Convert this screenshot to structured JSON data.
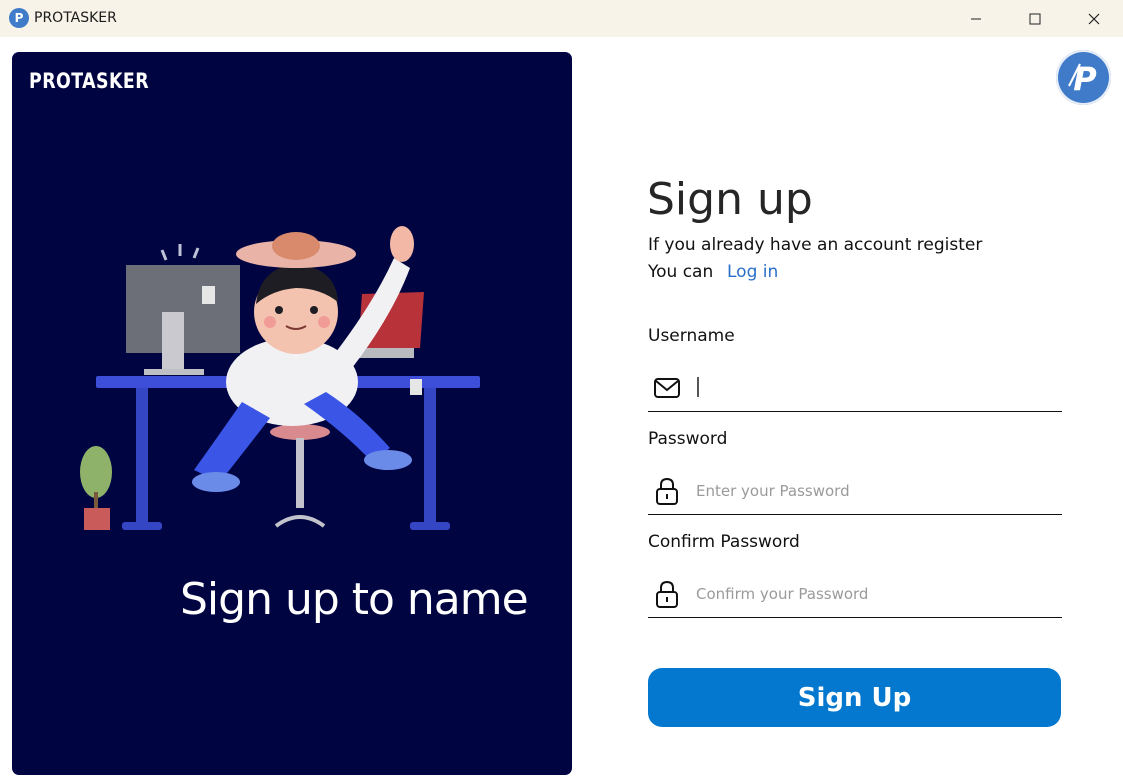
{
  "window": {
    "title": "PROTASKER",
    "logo_letter": "P"
  },
  "left_panel": {
    "brand": "PROTASKER",
    "tagline": "Sign up to name",
    "bg_color": "#000541"
  },
  "corner_logo": {
    "letter": "P",
    "color": "#3f7bc9"
  },
  "form": {
    "heading": "Sign up",
    "subtitle_line1": "If you already have an account register",
    "subtitle_line2": "You can",
    "login_link": "Log in",
    "username_label": "Username",
    "username_value": "",
    "password_label": "Password",
    "password_placeholder": "Enter your Password",
    "confirm_label": "Confirm Password",
    "confirm_placeholder": "Confirm your Password",
    "submit_label": "Sign Up",
    "accent_color": "#0478cf"
  }
}
